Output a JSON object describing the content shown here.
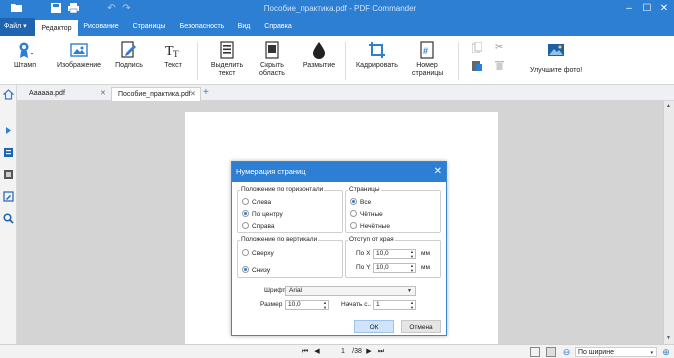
{
  "window": {
    "title": "Пособие_практика.pdf - PDF Commander"
  },
  "menu": {
    "file": "Файл",
    "tabs": [
      "Редактор",
      "Рисование",
      "Страницы",
      "Безопасность",
      "Вид",
      "Справка"
    ]
  },
  "ribbon": {
    "stamp": "Штамп",
    "image": "Изображение",
    "signature": "Подпись",
    "text": "Текст",
    "select_text": [
      "Выделить",
      "текст"
    ],
    "hide_area": [
      "Скрыть",
      "область"
    ],
    "blur": "Размытие",
    "crop": "Кадрировать",
    "page_number": [
      "Номер",
      "страницы"
    ],
    "enhance_photo": "Улучшите фото!"
  },
  "doc_tabs": [
    "Аааааа.pdf",
    "Пособие_практика.pdf"
  ],
  "dialog": {
    "title": "Нумерация страниц",
    "horizontal": {
      "legend": "Положение по горизонтали",
      "options": [
        "Слева",
        "По центру",
        "Справа"
      ],
      "selected": 1
    },
    "pages": {
      "legend": "Страницы",
      "options": [
        "Все",
        "Чётные",
        "Нечётные"
      ],
      "selected": 0
    },
    "vertical": {
      "legend": "Положение по вертикали",
      "options": [
        "Сверху",
        "Снизу"
      ],
      "selected": 1
    },
    "margin": {
      "legend": "Отступ от края",
      "x_label": "По X",
      "x_value": "10,0",
      "y_label": "По Y",
      "y_value": "10,0",
      "unit": "мм"
    },
    "font_label": "Шрифт",
    "font_value": "Arial",
    "size_label": "Размер",
    "size_value": "10,0",
    "start_label": "Начать с..",
    "start_value": "1",
    "ok": "ОК",
    "cancel": "Отмена"
  },
  "status": {
    "page_current": "1",
    "page_total": "/38",
    "zoom_mode": "По ширине"
  },
  "colors": {
    "accent": "#2d7fd4",
    "accent_dark": "#1f64b1"
  }
}
